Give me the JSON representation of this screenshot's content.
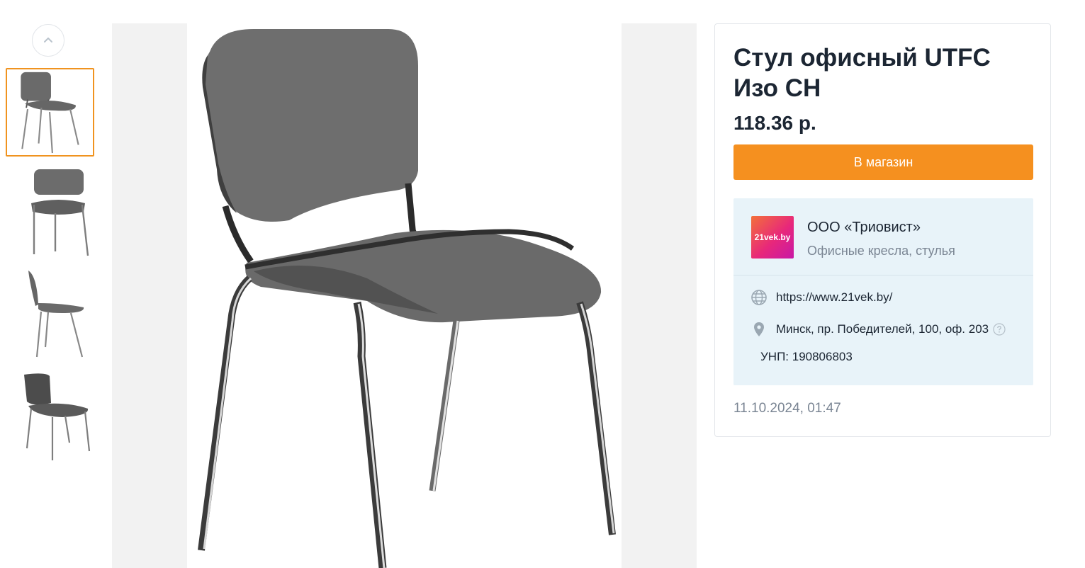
{
  "gallery": {
    "scroll_up_icon": "chevron-up-icon",
    "thumbnails": [
      {
        "alt": "chair-front-angle"
      },
      {
        "alt": "chair-front"
      },
      {
        "alt": "chair-side"
      },
      {
        "alt": "chair-back-angle"
      }
    ],
    "active_index": 0
  },
  "product": {
    "title": "Стул офисный UTFC Изо CH",
    "price": "118.36 р.",
    "shop_button": "В магазин"
  },
  "seller": {
    "logo_text": "21vek.by",
    "name": "ООО «Триовист»",
    "category": "Офисные кресла, стулья",
    "website": "https://www.21vek.by/",
    "address": "Минск, пр. Победителей, 100, оф. 203",
    "unp": "УНП: 190806803"
  },
  "updated_at": "11.10.2024, 01:47",
  "colors": {
    "accent": "#f5901f",
    "seller_bg": "#e8f3f9",
    "text": "#1c2633",
    "muted": "#7a8593"
  }
}
